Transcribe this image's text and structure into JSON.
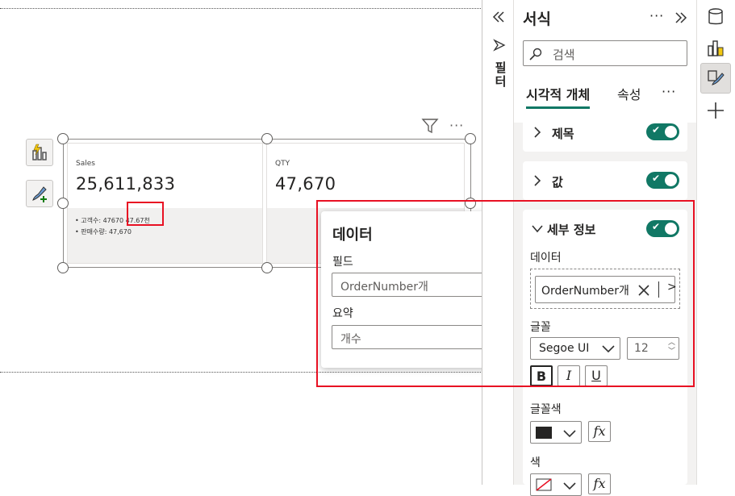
{
  "canvas": {
    "cards": [
      {
        "title": "Sales",
        "value": "25,611,833"
      },
      {
        "title": "QTY",
        "value": "47,670"
      }
    ],
    "details": [
      "• 고객수: 47670 47.67천",
      "• 판매수량: 47,670"
    ]
  },
  "popup": {
    "title": "데이터",
    "field_label": "필드",
    "field_value": "OrderNumber개",
    "summary_label": "요약",
    "summary_value": "개수"
  },
  "filter_rail": {
    "label": "필터"
  },
  "format_pane": {
    "title": "서식",
    "search_placeholder": "검색",
    "tabs": [
      "시각적 개체",
      "속성"
    ],
    "sections": {
      "title_label": "제목",
      "values_label": "값",
      "details_label": "세부 정보"
    },
    "details": {
      "data_label": "데이터",
      "data_value": "OrderNumber개",
      "font_label": "글꼴",
      "font_name": "Segoe UI",
      "font_size": "12",
      "bold": "B",
      "italic": "I",
      "underline": "U",
      "font_color_label": "글꼴색",
      "fx": "fx",
      "color_label": "색"
    }
  },
  "colors": {
    "accent": "#117865",
    "highlight": "#e81123"
  }
}
